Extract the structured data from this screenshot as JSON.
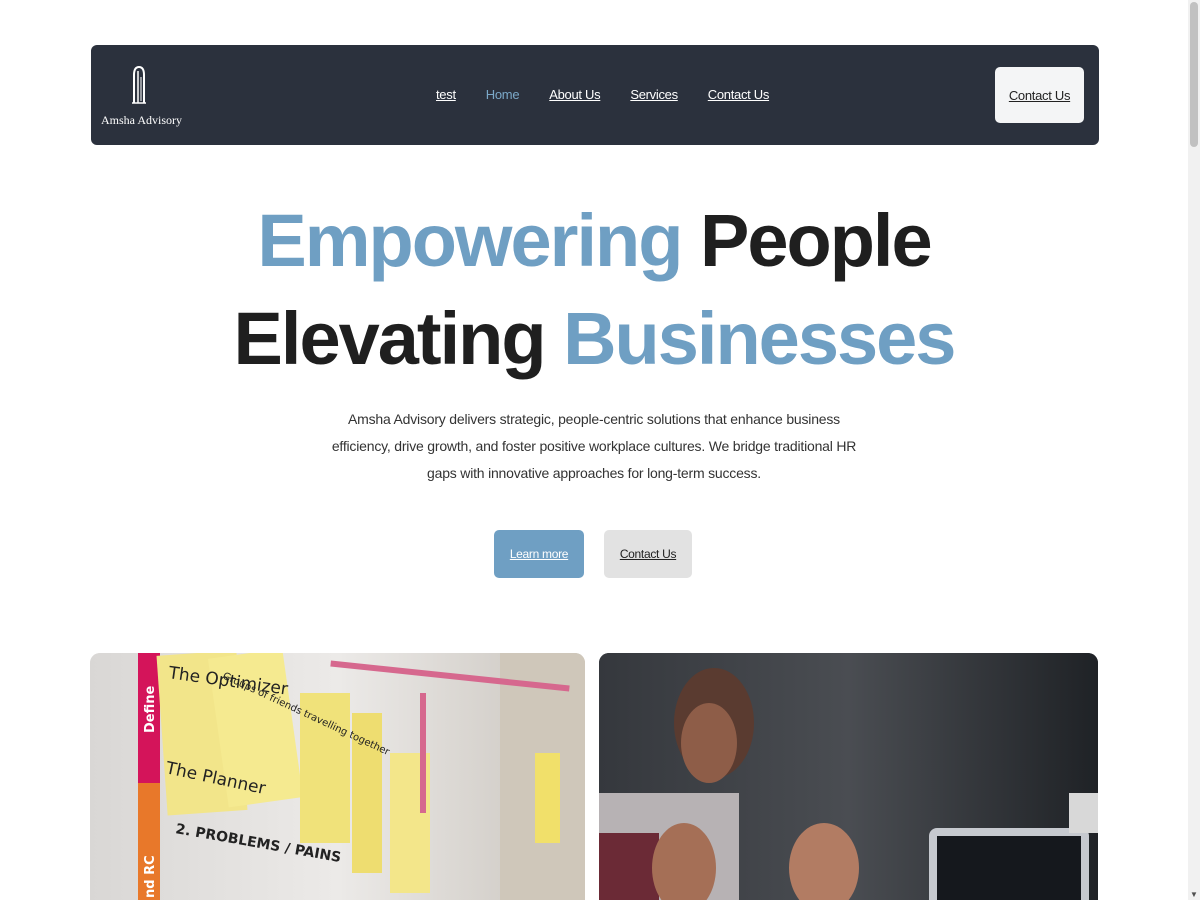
{
  "brand": {
    "name": "Amsha Advisory"
  },
  "nav": {
    "items": [
      {
        "label": "test",
        "active": false
      },
      {
        "label": "Home",
        "active": true
      },
      {
        "label": "About Us",
        "active": false
      },
      {
        "label": "Services",
        "active": false
      },
      {
        "label": "Contact Us",
        "active": false
      }
    ],
    "cta_label": "Contact Us"
  },
  "hero": {
    "line1_accent": "Empowering",
    "line1_rest": "People",
    "line2_start": "Elevating",
    "line2_accent": "Businesses",
    "description": "Amsha Advisory delivers strategic, people-centric solutions that enhance business efficiency, drive growth, and foster positive workplace cultures. We bridge traditional HR gaps with innovative approaches for long-term success.",
    "primary_button": "Learn more",
    "secondary_button": "Contact Us"
  },
  "gallery": {
    "left_sticky_notes": [
      "The Optimizer",
      "The Planner",
      "Groups of friends travelling together",
      "2. PROBLEMS / PAINS",
      "Define"
    ],
    "right_image": "person-with-laptop"
  },
  "colors": {
    "navbar_bg": "#2b313d",
    "accent": "#6f9fc3",
    "text_dark": "#1f1f1f"
  }
}
